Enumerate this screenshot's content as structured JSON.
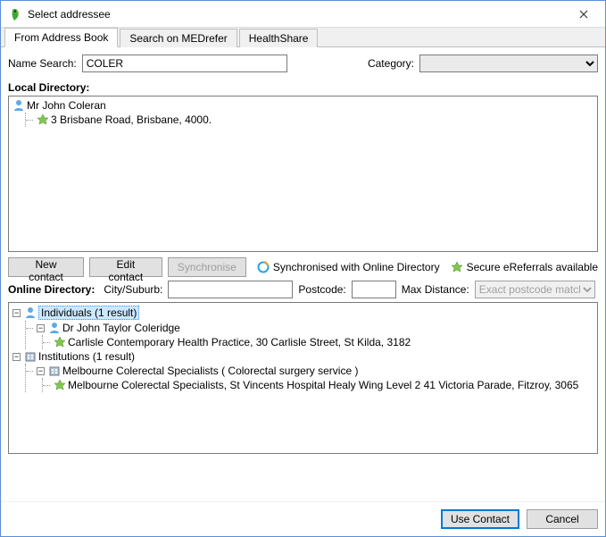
{
  "window": {
    "title": "Select addressee"
  },
  "tabs": [
    {
      "label": "From Address Book",
      "active": true
    },
    {
      "label": "Search on MEDrefer",
      "active": false
    },
    {
      "label": "HealthShare",
      "active": false
    }
  ],
  "search": {
    "name_label": "Name Search:",
    "name_value": "COLER",
    "category_label": "Category:",
    "category_value": ""
  },
  "local": {
    "title": "Local Directory:",
    "entry_name": "Mr John Coleran",
    "entry_address": "3 Brisbane Road, Brisbane, 4000."
  },
  "buttons": {
    "new_contact": "New contact",
    "edit_contact": "Edit contact",
    "synchronise": "Synchronise"
  },
  "legends": {
    "sync": "Synchronised with Online Directory",
    "ereferrals": "Secure eReferrals available"
  },
  "online_filters": {
    "title": "Online Directory:",
    "city_label": "City/Suburb:",
    "city_value": "",
    "postcode_label": "Postcode:",
    "postcode_value": "",
    "maxdist_label": "Max Distance:",
    "maxdist_value": "Exact postcode match"
  },
  "online_tree": {
    "individuals_label": "Individuals (1 result)",
    "ind_name": "Dr John Taylor Coleridge",
    "ind_addr": "Carlisle Contemporary Health Practice, 30 Carlisle Street, St Kilda, 3182",
    "institutions_label": "Institutions (1 result)",
    "inst_name": "Melbourne Colerectal Specialists  ( Colorectal surgery service )",
    "inst_addr": "Melbourne Colerectal Specialists, St Vincents Hospital Healy Wing Level 2 41 Victoria Parade, Fitzroy, 3065"
  },
  "footer": {
    "use_contact": "Use Contact",
    "cancel": "Cancel"
  }
}
